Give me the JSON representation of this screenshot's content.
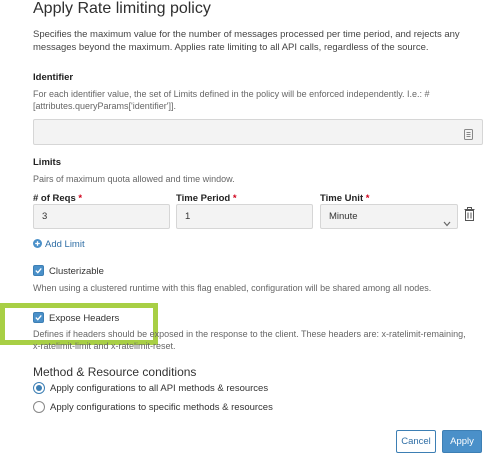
{
  "policy": {
    "title": "Apply Rate limiting policy",
    "description": "Specifies the maximum value for the number of messages processed per time period, and rejects any messages beyond the maximum. Applies rate limiting to all API calls, regardless of the source."
  },
  "identifier": {
    "label": "Identifier",
    "description": "For each identifier value, the set of Limits defined in the policy will be enforced independently. I.e.: #[attributes.queryParams['identifier']].",
    "value": ""
  },
  "limits": {
    "label": "Limits",
    "description": "Pairs of maximum quota allowed and time window.",
    "columns": {
      "reqs": "# of Reqs",
      "period": "Time Period",
      "unit": "Time Unit",
      "required_mark": "*"
    },
    "rows": [
      {
        "reqs": "3",
        "period": "1",
        "unit": "Minute"
      }
    ],
    "add_limit": "Add Limit"
  },
  "clusterizable": {
    "label": "Clusterizable",
    "checked": true,
    "description": "When using a clustered runtime with this flag enabled, configuration will be shared among all nodes."
  },
  "expose_headers": {
    "label": "Expose Headers",
    "checked": true,
    "description": "Defines if headers should be exposed in the response to the client. These headers are: x-ratelimit-remaining, x-ratelimit-limit and x-ratelimit-reset."
  },
  "method_conditions": {
    "heading": "Method & Resource conditions",
    "options": [
      {
        "label": "Apply configurations to all API methods & resources",
        "selected": true
      },
      {
        "label": "Apply configurations to specific methods & resources",
        "selected": false
      }
    ]
  },
  "buttons": {
    "cancel": "Cancel",
    "apply": "Apply"
  },
  "colors": {
    "accent": "#4a90c9",
    "highlight": "#a8cf45",
    "required": "#d0021b"
  }
}
